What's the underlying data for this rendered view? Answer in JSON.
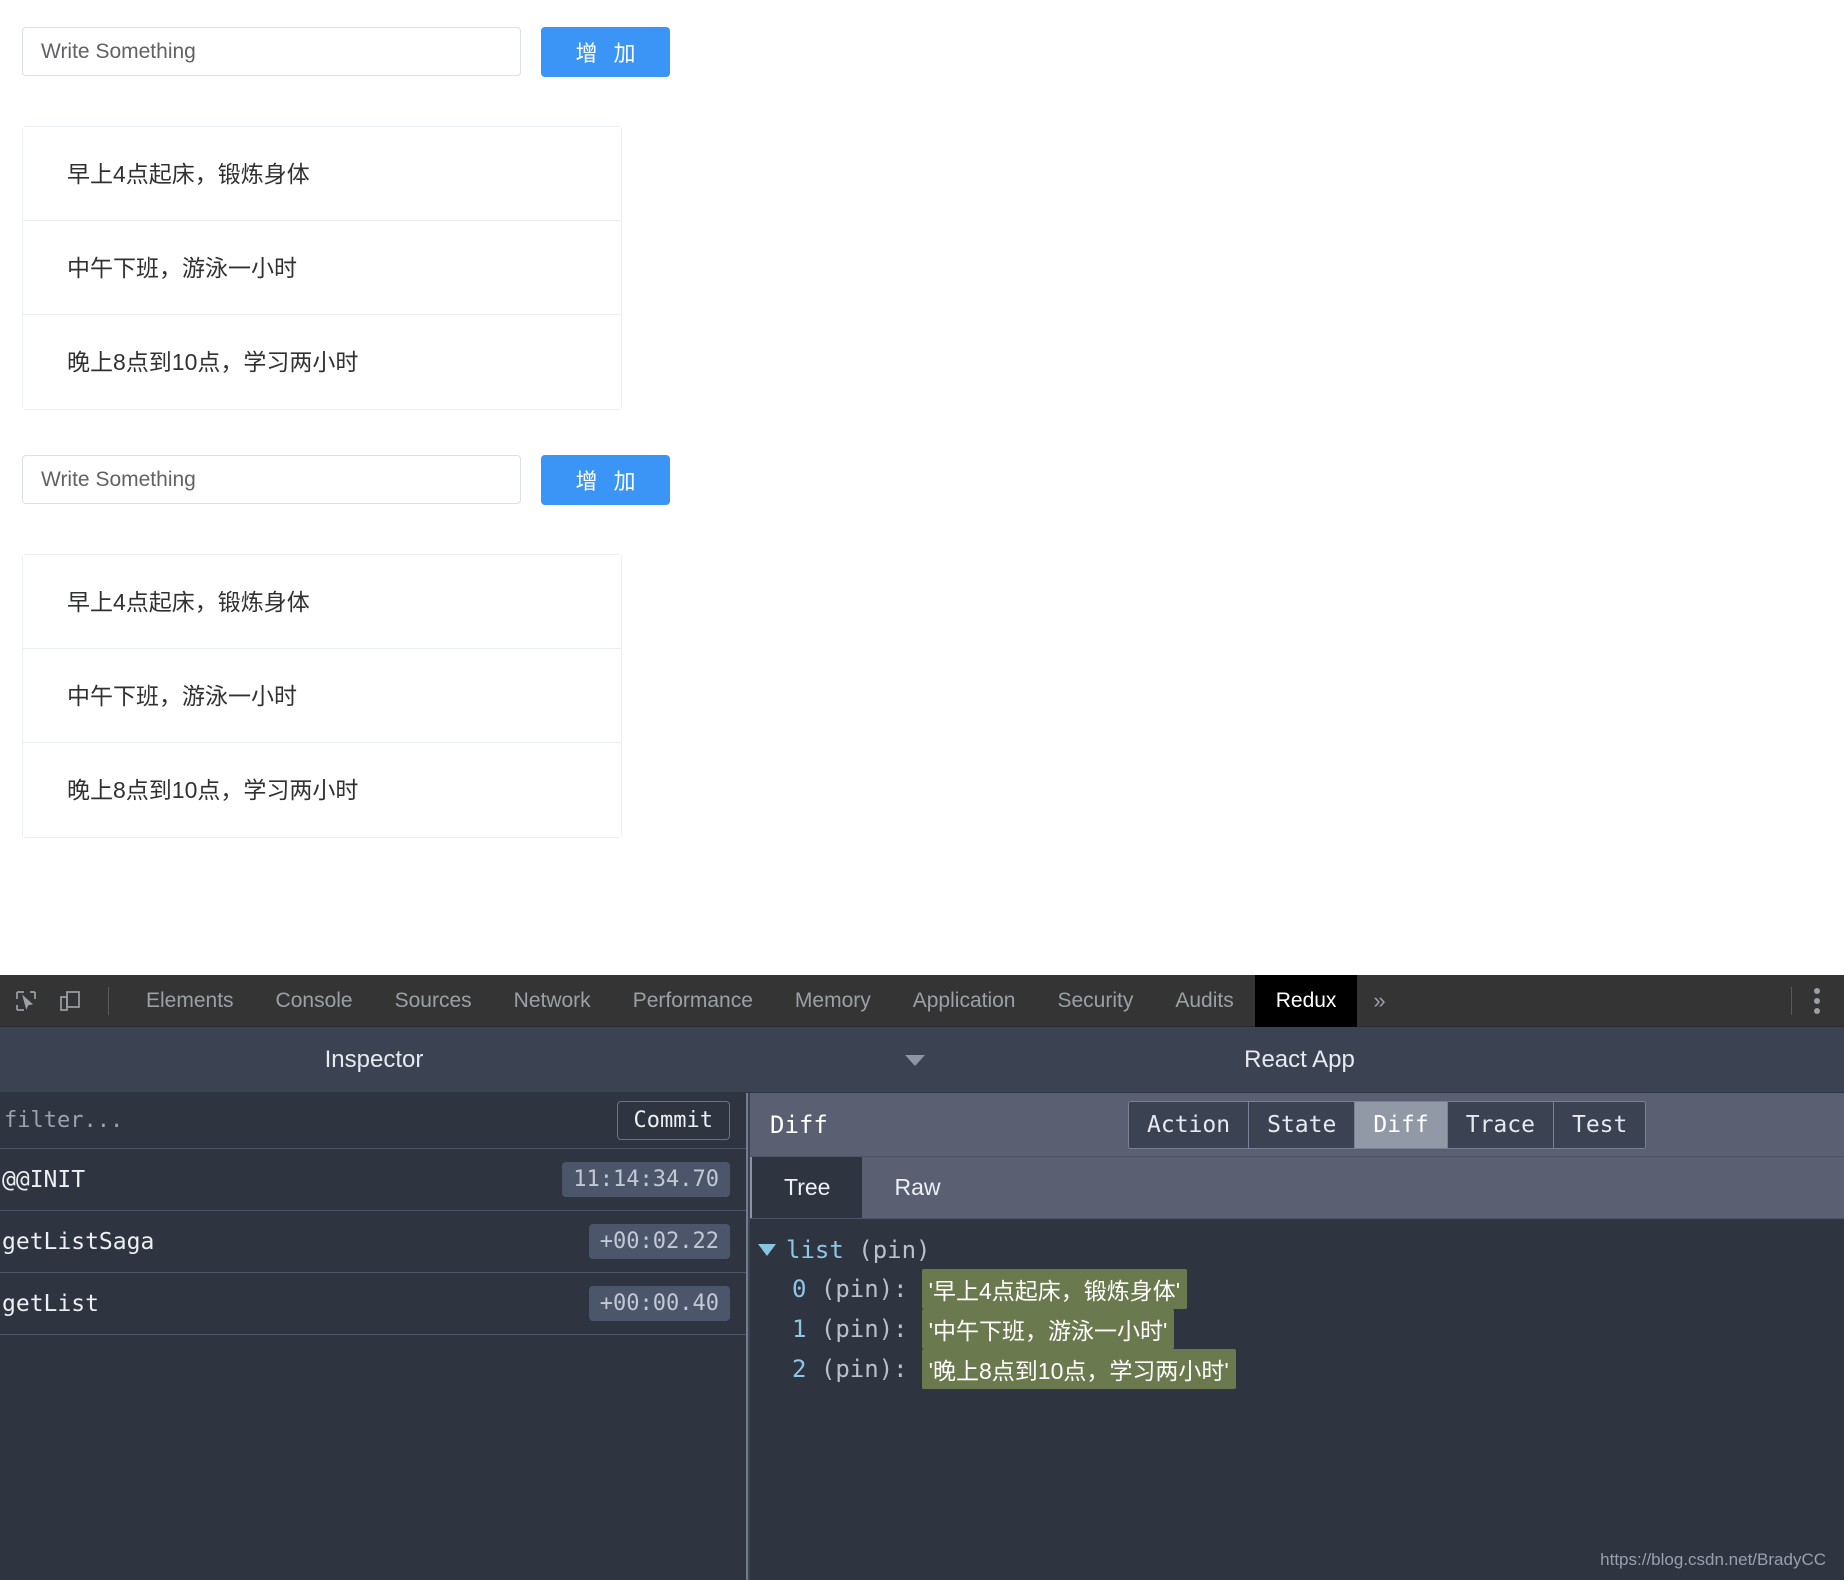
{
  "app": {
    "blocks": [
      {
        "input": {
          "placeholder": "Write Something",
          "value": ""
        },
        "add_button": "增 加",
        "items": [
          "早上4点起床，锻炼身体",
          "中午下班，游泳一小时",
          "晚上8点到10点，学习两小时"
        ]
      },
      {
        "input": {
          "placeholder": "Write Something",
          "value": ""
        },
        "add_button": "增 加",
        "items": [
          "早上4点起床，锻炼身体",
          "中午下班，游泳一小时",
          "晚上8点到10点，学习两小时"
        ]
      }
    ]
  },
  "devtools": {
    "tabs": [
      {
        "label": "Elements",
        "selected": false
      },
      {
        "label": "Console",
        "selected": false
      },
      {
        "label": "Sources",
        "selected": false
      },
      {
        "label": "Network",
        "selected": false
      },
      {
        "label": "Performance",
        "selected": false
      },
      {
        "label": "Memory",
        "selected": false
      },
      {
        "label": "Application",
        "selected": false
      },
      {
        "label": "Security",
        "selected": false
      },
      {
        "label": "Audits",
        "selected": false
      },
      {
        "label": "Redux",
        "selected": true
      }
    ],
    "more_tabs_label": "»",
    "icons": {
      "inspect": "inspect-element-icon",
      "device": "device-toolbar-icon",
      "menu": "kebab-menu-icon"
    }
  },
  "redux": {
    "left_panel": {
      "title": "Inspector",
      "filter": {
        "placeholder": "filter...",
        "value": ""
      },
      "commit_button": "Commit",
      "actions": [
        {
          "name": "@@INIT",
          "time": "11:14:34.70"
        },
        {
          "name": "getListSaga",
          "time": "+00:02.22"
        },
        {
          "name": "getList",
          "time": "+00:00.40"
        }
      ]
    },
    "right_panel": {
      "title": "React App",
      "diff_label": "Diff",
      "view_tabs": [
        {
          "label": "Action",
          "selected": false
        },
        {
          "label": "State",
          "selected": false
        },
        {
          "label": "Diff",
          "selected": true
        },
        {
          "label": "Trace",
          "selected": false
        },
        {
          "label": "Test",
          "selected": false
        }
      ],
      "sub_tabs": [
        {
          "label": "Tree",
          "selected": true
        },
        {
          "label": "Raw",
          "selected": false
        }
      ],
      "tree": {
        "root_key": "list",
        "root_pin": "(pin)",
        "children": [
          {
            "index": "0",
            "pin": "(pin):",
            "value": "'早上4点起床，锻炼身体'"
          },
          {
            "index": "1",
            "pin": "(pin):",
            "value": "'中午下班，游泳一小时'"
          },
          {
            "index": "2",
            "pin": "(pin):",
            "value": "'晚上8点到10点，学习两小时'"
          }
        ]
      }
    },
    "watermark": "https://blog.csdn.net/BradyCC"
  },
  "colors": {
    "accent_blue": "#3a95f7",
    "devtools_bar": "#343434",
    "panel_bg": "#2e3440",
    "header_bg": "#3b4252",
    "diff_added": "#6b7a4e"
  }
}
